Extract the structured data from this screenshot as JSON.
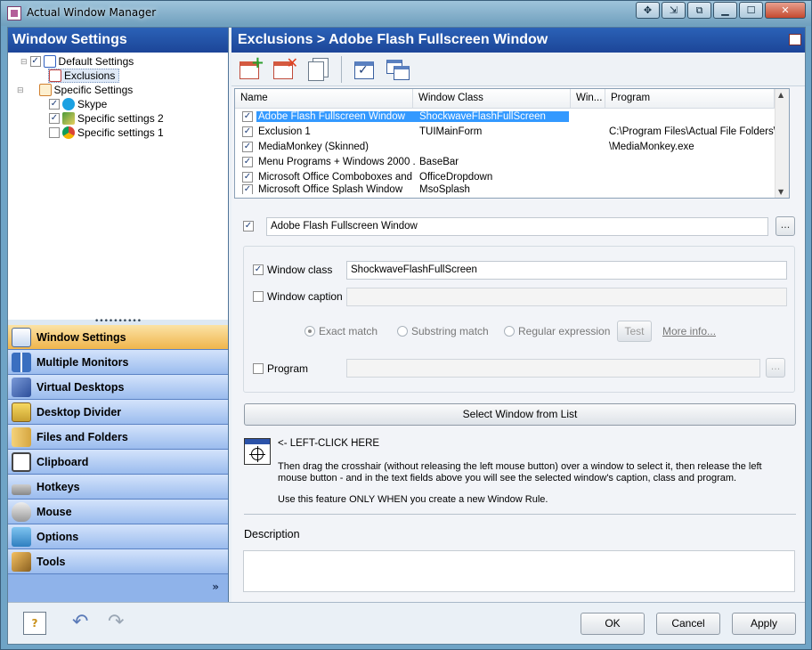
{
  "window": {
    "title": "Actual Window Manager"
  },
  "left_panel": {
    "header": "Window Settings",
    "tree": [
      {
        "label": "Default Settings",
        "checked": true
      },
      {
        "label": "Exclusions",
        "checked": false
      },
      {
        "label": "Specific Settings",
        "checked": false
      },
      {
        "label": "Skype",
        "checked": true
      },
      {
        "label": "Specific settings 2",
        "checked": true
      },
      {
        "label": "Specific settings 1",
        "checked": false
      }
    ],
    "nav": [
      {
        "label": "Window Settings",
        "icon": "window-settings-icon",
        "active": true
      },
      {
        "label": "Multiple Monitors",
        "icon": "monitors-icon"
      },
      {
        "label": "Virtual Desktops",
        "icon": "virtual-desktops-icon"
      },
      {
        "label": "Desktop Divider",
        "icon": "desktop-divider-icon"
      },
      {
        "label": "Files and Folders",
        "icon": "files-folders-icon"
      },
      {
        "label": "Clipboard",
        "icon": "clipboard-icon"
      },
      {
        "label": "Hotkeys",
        "icon": "keyboard-icon"
      },
      {
        "label": "Mouse",
        "icon": "mouse-icon"
      },
      {
        "label": "Options",
        "icon": "options-icon"
      },
      {
        "label": "Tools",
        "icon": "tools-icon"
      }
    ]
  },
  "right_panel": {
    "header": "Exclusions > Adobe Flash Fullscreen Window",
    "list": {
      "columns": [
        "Name",
        "Window Class",
        "Win...",
        "Program"
      ],
      "rows": [
        {
          "checked": true,
          "name": "Adobe Flash Fullscreen Window",
          "class": "ShockwaveFlashFullScreen",
          "win": "",
          "program": ""
        },
        {
          "checked": true,
          "name": "Exclusion 1",
          "class": "TUIMainForm",
          "win": "",
          "program": "C:\\Program Files\\Actual File Folders\\..."
        },
        {
          "checked": true,
          "name": "MediaMonkey (Skinned)",
          "class": "",
          "win": "",
          "program": "\\MediaMonkey.exe"
        },
        {
          "checked": true,
          "name": "Menu Programs + Windows 2000 ...",
          "class": "BaseBar",
          "win": "",
          "program": ""
        },
        {
          "checked": true,
          "name": "Microsoft Office Comboboxes and ...",
          "class": "OfficeDropdown",
          "win": "",
          "program": ""
        },
        {
          "checked": true,
          "name": "Microsoft Office Splash Window",
          "class": "MsoSplash",
          "win": "",
          "program": ""
        }
      ]
    },
    "rule_name": "Adobe Flash Fullscreen Window",
    "browse_label": "...",
    "window_class_label": "Window class",
    "window_class_value": "ShockwaveFlashFullScreen",
    "window_caption_label": "Window caption",
    "window_caption_value": "",
    "match_options": {
      "exact": "Exact match",
      "substring": "Substring match",
      "regex": "Regular expression",
      "test": "Test",
      "more_info": "More info..."
    },
    "program_label": "Program",
    "program_value": "",
    "select_window_button": "Select Window from List",
    "crosshair_label": "<- LEFT-CLICK HERE",
    "instruction_1": "Then drag the crosshair (without releasing the left mouse button) over a window to select it, then release the left mouse button - and in the text fields above you will see the selected window's caption, class and program.",
    "instruction_2": "Use this feature ONLY WHEN you create a new Window Rule.",
    "description_label": "Description",
    "description_value": ""
  },
  "footer": {
    "ok": "OK",
    "cancel": "Cancel",
    "apply": "Apply"
  },
  "colors": {
    "header_blue": "#2b62b7",
    "selected_row": "#3399ff",
    "active_nav": "#f0b54c"
  }
}
